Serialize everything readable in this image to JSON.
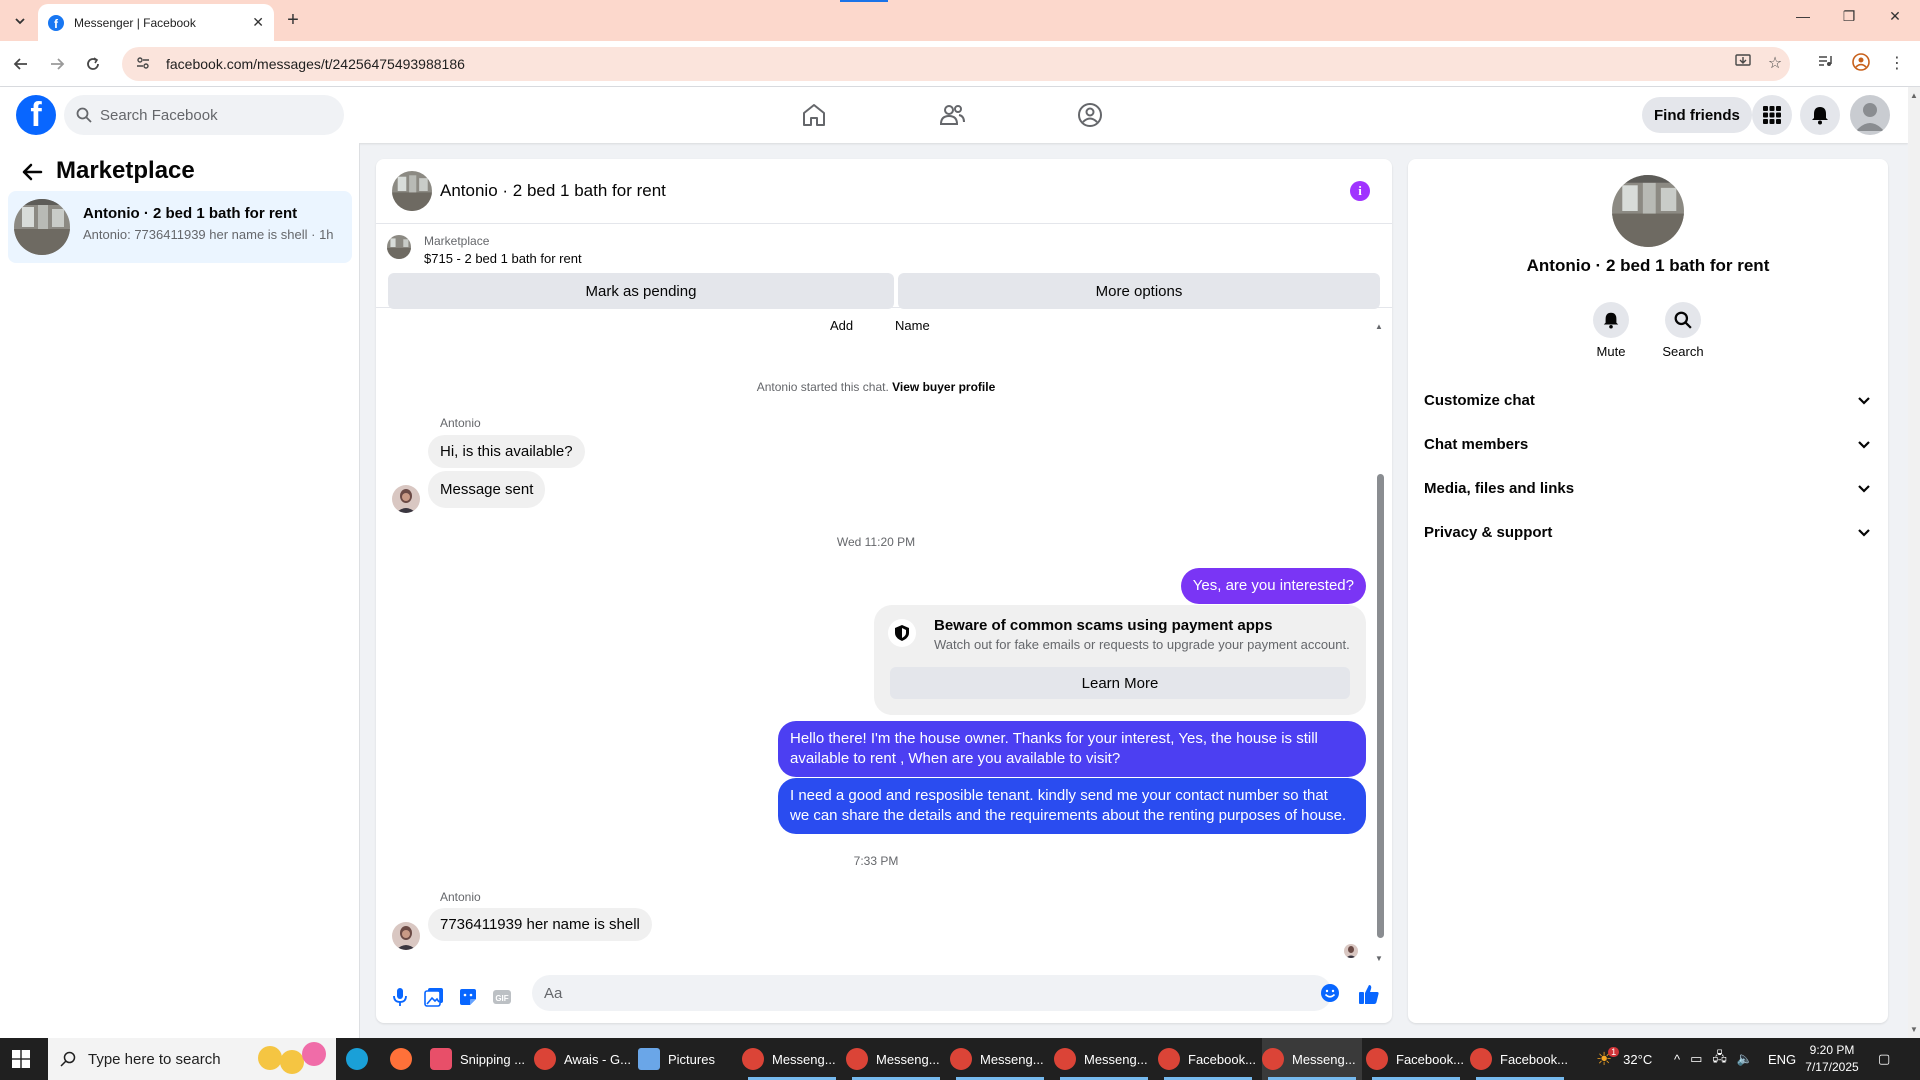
{
  "browser": {
    "tab_title": "Messenger | Facebook",
    "url": "facebook.com/messages/t/24256475493988186",
    "new_tab": "+",
    "close_tab": "✕"
  },
  "fb": {
    "search_placeholder": "Search Facebook",
    "find_friends": "Find friends"
  },
  "sidebar": {
    "title": "Marketplace",
    "conversations": [
      {
        "name": "Antonio · 2 bed 1 bath for rent",
        "preview": "Antonio: 7736411939 her name is shell · 1h"
      }
    ]
  },
  "chat": {
    "title": "Antonio · 2 bed 1 bath for rent",
    "listing_label": "Marketplace",
    "listing_price": "$715 - 2 bed 1 bath for rent",
    "mark_pending": "Mark as pending",
    "more_options": "More options",
    "add": "Add",
    "name": "Name",
    "started_text": "Antonio started this chat.",
    "view_buyer": "View buyer profile",
    "sender1": "Antonio",
    "msg_in_1": "Hi, is this available?",
    "msg_in_2": "Message sent",
    "ts1": "Wed 11:20 PM",
    "msg_out_1": "Yes, are you interested?",
    "scam_title": "Beware of common scams using payment apps",
    "scam_desc": "Watch out for fake emails or requests to upgrade your payment account.",
    "learn_more": "Learn More",
    "msg_out_2a": "Hello there! I'm the house owner. Thanks for your interest, Yes, the house is still",
    "msg_out_2b": "available to rent , When are you available to visit?",
    "msg_out_3a": "I need a good and resposible tenant.  kindly send me your contact number so that",
    "msg_out_3b": "we can share the details and the requirements about the renting purposes of house.",
    "ts2": "7:33 PM",
    "sender2": "Antonio",
    "msg_in_3": "7736411939 her name is shell",
    "composer_placeholder": "Aa"
  },
  "details": {
    "name": "Antonio · 2 bed 1 bath for rent",
    "mute": "Mute",
    "search": "Search",
    "sections": [
      "Customize chat",
      "Chat members",
      "Media, files and links",
      "Privacy & support"
    ]
  },
  "taskbar": {
    "search_text": "Type here to search",
    "apps": [
      "Snipping ...",
      "Awais - G...",
      "Pictures",
      "Messeng...",
      "Messeng...",
      "Messeng...",
      "Messeng...",
      "Facebook...",
      "Messeng...",
      "Facebook...",
      "Facebook..."
    ],
    "weather_badge": "1",
    "temperature": "32°C",
    "language": "ENG",
    "time": "9:20 PM",
    "date": "7/17/2025"
  },
  "colors": {
    "fb_blue": "#0866ff",
    "outgoing_bubble": "#5b33f0",
    "info_purple": "#a033ff",
    "tabstrip": "#fcd8cc"
  }
}
